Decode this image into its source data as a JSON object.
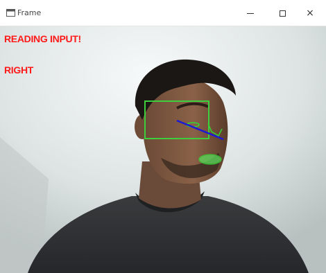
{
  "window": {
    "title": "Frame",
    "controls": {
      "minimize": "minimize",
      "maximize": "maximize",
      "close": "×"
    }
  },
  "overlay": {
    "status_text": "READING INPUT!",
    "direction_text": "RIGHT"
  },
  "colors": {
    "overlay_text": "#ff1a1a",
    "face_box": "#3ecf3e",
    "gaze_line": "#1a1ad6",
    "landmarks": "#33d633"
  },
  "icons": {
    "app": "window-frame-icon",
    "minimize": "minimize-icon",
    "maximize": "maximize-icon",
    "close": "close-icon"
  }
}
